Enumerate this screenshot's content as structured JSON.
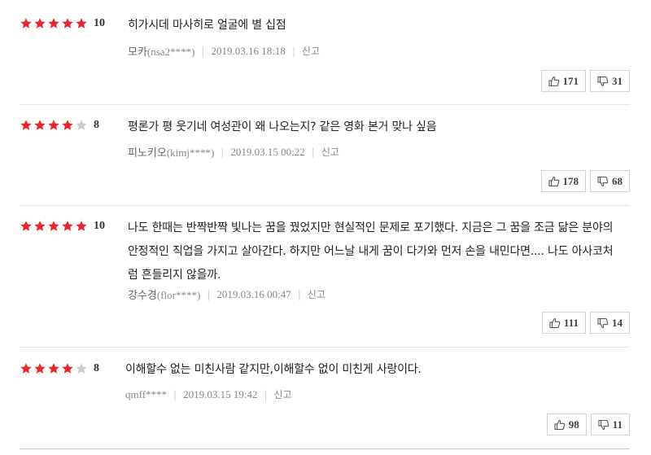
{
  "colors": {
    "star_on": "#e8262b",
    "star_off": "#cccccc"
  },
  "icons": {
    "star": "star-icon",
    "like": "thumbs-up-icon",
    "dislike": "thumbs-down-icon"
  },
  "reviews": [
    {
      "stars_filled": 5,
      "stars_total": 5,
      "score": "10",
      "text": "히가시데 마사히로 얼굴에 별 십점",
      "user": "모카",
      "user_id": "(nsa2****)",
      "date": "2019.03.16 18:18",
      "report": "신고",
      "likes": "171",
      "dislikes": "31"
    },
    {
      "stars_filled": 4,
      "stars_total": 5,
      "score": "8",
      "text": "평론가 평 웃기네 여성관이 왜 나오는지? 같은 영화 본거 맞나 싶음",
      "user": "피노키오",
      "user_id": "(kimj****)",
      "date": "2019.03.15 00:22",
      "report": "신고",
      "likes": "178",
      "dislikes": "68"
    },
    {
      "stars_filled": 5,
      "stars_total": 5,
      "score": "10",
      "text": "나도 한때는 반짝반짝 빛나는 꿈을 꿨었지만 현실적인 문제로 포기했다. 지금은 그 꿈을 조금 닮은 분야의 안정적인 직업을 가지고 살아간다. 하지만 어느날 내게 꿈이 다가와 먼저 손을 내민다면.... 나도 아사코처럼 흔들리지 않을까.",
      "user": "강수경",
      "user_id": "(flor****)",
      "date": "2019.03.16 00:47",
      "report": "신고",
      "likes": "111",
      "dislikes": "14"
    },
    {
      "stars_filled": 4,
      "stars_total": 5,
      "score": "8",
      "text": "이해할수 없는 미친사람 같지만,이해할수 없이 미친게 사랑이다.",
      "user": "",
      "user_id": "qmff****",
      "date": "2019.03.15 19:42",
      "report": "신고",
      "likes": "98",
      "dislikes": "11"
    }
  ]
}
